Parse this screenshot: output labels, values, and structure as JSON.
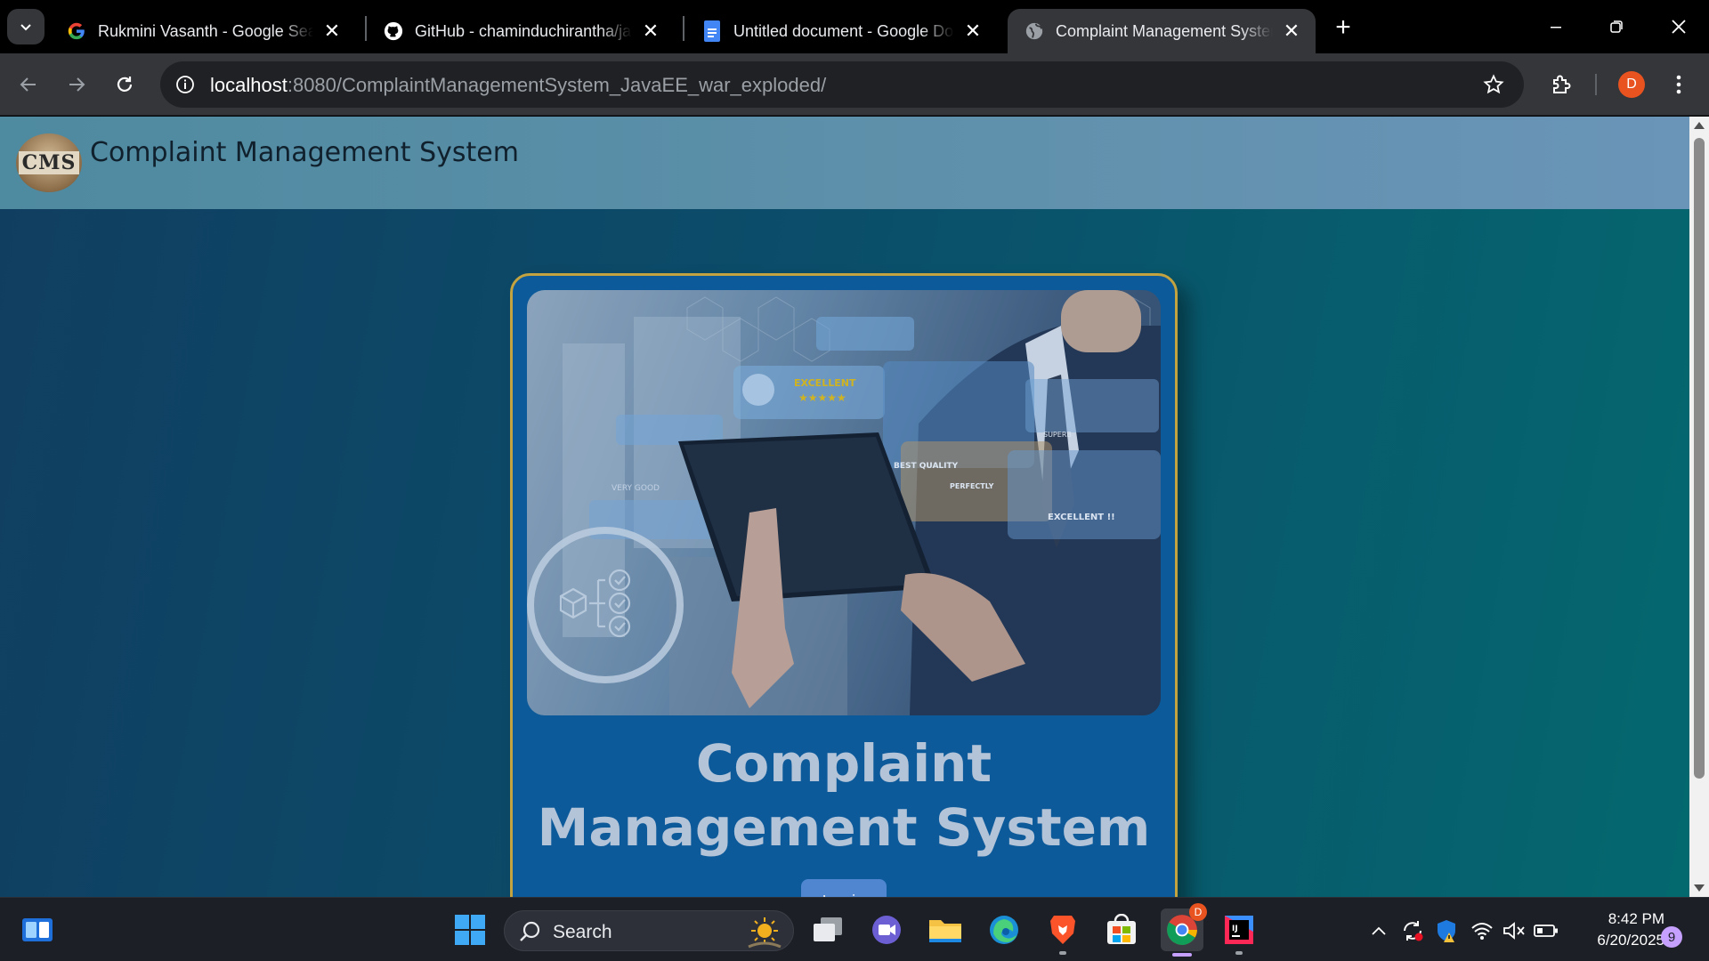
{
  "tabs": [
    {
      "title": "Rukmini Vasanth - Google Search",
      "favicon": "google-icon"
    },
    {
      "title": "GitHub - chaminduchirantha/java",
      "favicon": "github-icon"
    },
    {
      "title": "Untitled document - Google Docs",
      "favicon": "docs-icon"
    },
    {
      "title": "Complaint Management System",
      "favicon": "globe-icon",
      "active": true
    }
  ],
  "address_bar": {
    "host": "localhost",
    "path": ":8080/ComplaintManagementSystem_JavaEE_war_exploded/"
  },
  "profile_initial": "D",
  "site": {
    "logo_text": "CMS",
    "header_title": "Complaint Management System",
    "card_title": "Complaint Management System",
    "login_label": "Login",
    "hero_texts": [
      "EXCELLENT",
      "BEST QUALITY",
      "PERFECTLY",
      "EXCELLENT !!",
      "SUPERB",
      "VERY GOOD"
    ]
  },
  "taskbar": {
    "search_label": "Search",
    "chrome_badge": "D",
    "time": "8:42 PM",
    "date": "6/20/2025",
    "notification_count": "9"
  },
  "colors": {
    "page_bg_start": "#103e61",
    "page_bg_end": "#04686f",
    "card_bg": "#0c5a9a",
    "card_border": "#c2a340",
    "header_bg": "#6091ac"
  }
}
